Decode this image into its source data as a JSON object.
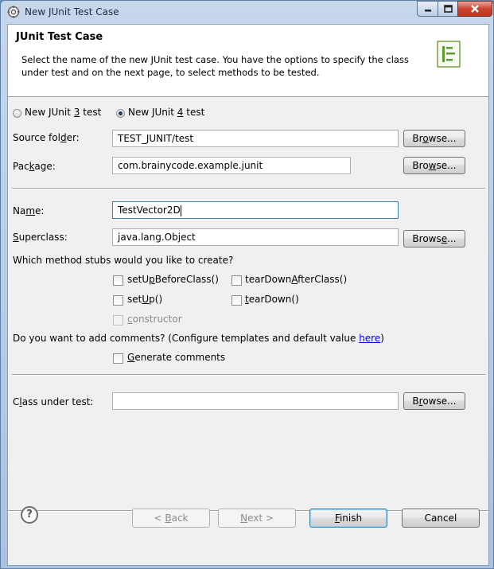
{
  "window": {
    "title": "New JUnit Test Case",
    "icon": "gear-icon"
  },
  "banner": {
    "title": "JUnit Test Case",
    "description": "Select the name of the new JUnit test case. You have the options to specify the class under test and on the next page, to select methods to be tested.",
    "icon": "junit-test-case-icon"
  },
  "version": {
    "junit3": {
      "pre": "New JUnit ",
      "key": "3",
      "post": " test",
      "selected": false
    },
    "junit4": {
      "pre": "New JUnit ",
      "key": "4",
      "post": " test",
      "selected": true
    }
  },
  "source_folder": {
    "label_pre": "Source fol",
    "label_key": "d",
    "label_post": "er:",
    "value": "TEST_JUNIT/test",
    "browse_pre": "Br",
    "browse_key": "o",
    "browse_post": "wse..."
  },
  "package": {
    "label_pre": "Pac",
    "label_key": "k",
    "label_post": "age:",
    "value": "com.brainycode.example.junit",
    "browse_pre": "Bro",
    "browse_key": "w",
    "browse_post": "se..."
  },
  "name": {
    "label_pre": "Na",
    "label_key": "m",
    "label_post": "e:",
    "value": "TestVector2D"
  },
  "superclass": {
    "label_pre": "",
    "label_key": "S",
    "label_post": "uperclass:",
    "value": "java.lang.Object",
    "browse_pre": "Brows",
    "browse_key": "e",
    "browse_post": "..."
  },
  "stubs": {
    "question": "Which method stubs would you like to create?",
    "setUpBeforeClass": {
      "pre": "setU",
      "key": "p",
      "post": "BeforeClass()",
      "checked": false
    },
    "tearDownAfterClass": {
      "pre": "tearDown",
      "key": "A",
      "post": "fterClass()",
      "checked": false
    },
    "setUp": {
      "pre": "set",
      "key": "U",
      "post": "p()",
      "checked": false
    },
    "tearDown": {
      "pre": "",
      "key": "t",
      "post": "earDown()",
      "checked": false
    },
    "constructor": {
      "pre": "",
      "key": "c",
      "post": "onstructor",
      "checked": false
    }
  },
  "comments": {
    "question_pre": "Do you want to add comments? (Configure templates and default value ",
    "link": "here",
    "question_post": ")",
    "generate": {
      "pre": "",
      "key": "G",
      "post": "enerate comments",
      "checked": false
    }
  },
  "class_under_test": {
    "label_pre": "C",
    "label_key": "l",
    "label_post": "ass under test:",
    "value": "",
    "browse_pre": "B",
    "browse_key": "r",
    "browse_post": "owse..."
  },
  "footer": {
    "help_glyph": "?",
    "back": {
      "pre": "< ",
      "key": "B",
      "post": "ack"
    },
    "next": {
      "pre": "",
      "key": "N",
      "post": "ext >"
    },
    "finish": {
      "pre": "",
      "key": "F",
      "post": "inish"
    },
    "cancel": "Cancel"
  }
}
